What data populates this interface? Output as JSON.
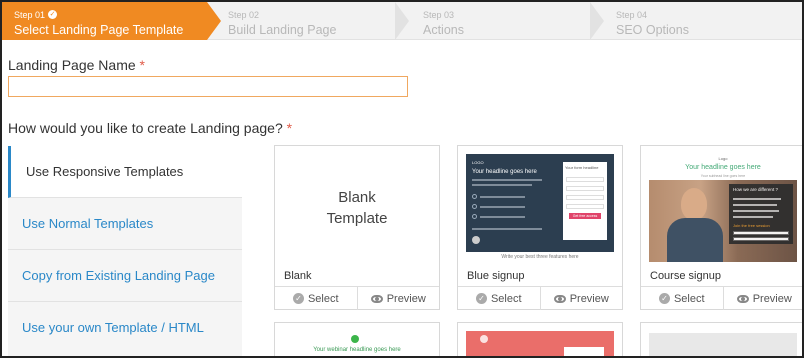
{
  "wizard": {
    "steps": [
      {
        "num": "Step 01",
        "name": "Select Landing Page Template",
        "active": true
      },
      {
        "num": "Step 02",
        "name": "Build Landing Page"
      },
      {
        "num": "Step 03",
        "name": "Actions"
      },
      {
        "num": "Step 04",
        "name": "SEO Options"
      }
    ]
  },
  "form": {
    "name_label": "Landing Page Name",
    "required_mark": "*",
    "name_value": "",
    "create_label": "How would you like to create Landing page?"
  },
  "options": [
    {
      "label": "Use Responsive Templates"
    },
    {
      "label": "Use Normal Templates"
    },
    {
      "label": "Copy from Existing Landing Page"
    },
    {
      "label": "Use your own Template / HTML"
    }
  ],
  "templates": [
    {
      "title": "Blank",
      "thumb_text": "Blank Template"
    },
    {
      "title": "Blue signup",
      "thumb": {
        "logo": "LOGO",
        "headline": "Your headline goes here",
        "form_title": "Your form headline",
        "button": "Get free access",
        "features": "Write your best three features here"
      }
    },
    {
      "title": "Course signup",
      "thumb": {
        "logo": "Logo",
        "headline": "Your headline goes here",
        "subline": "Your subhead line goes here",
        "panel_title": "How we are different ?",
        "join": "Join the free session"
      }
    }
  ],
  "card_actions": {
    "select": "Select",
    "preview": "Preview"
  },
  "lower_cards": {
    "webinar_headline": "Your webinar headline goes here"
  },
  "colors": {
    "accent": "#f08a22",
    "link": "#2a88c8",
    "required": "#e05b48"
  }
}
